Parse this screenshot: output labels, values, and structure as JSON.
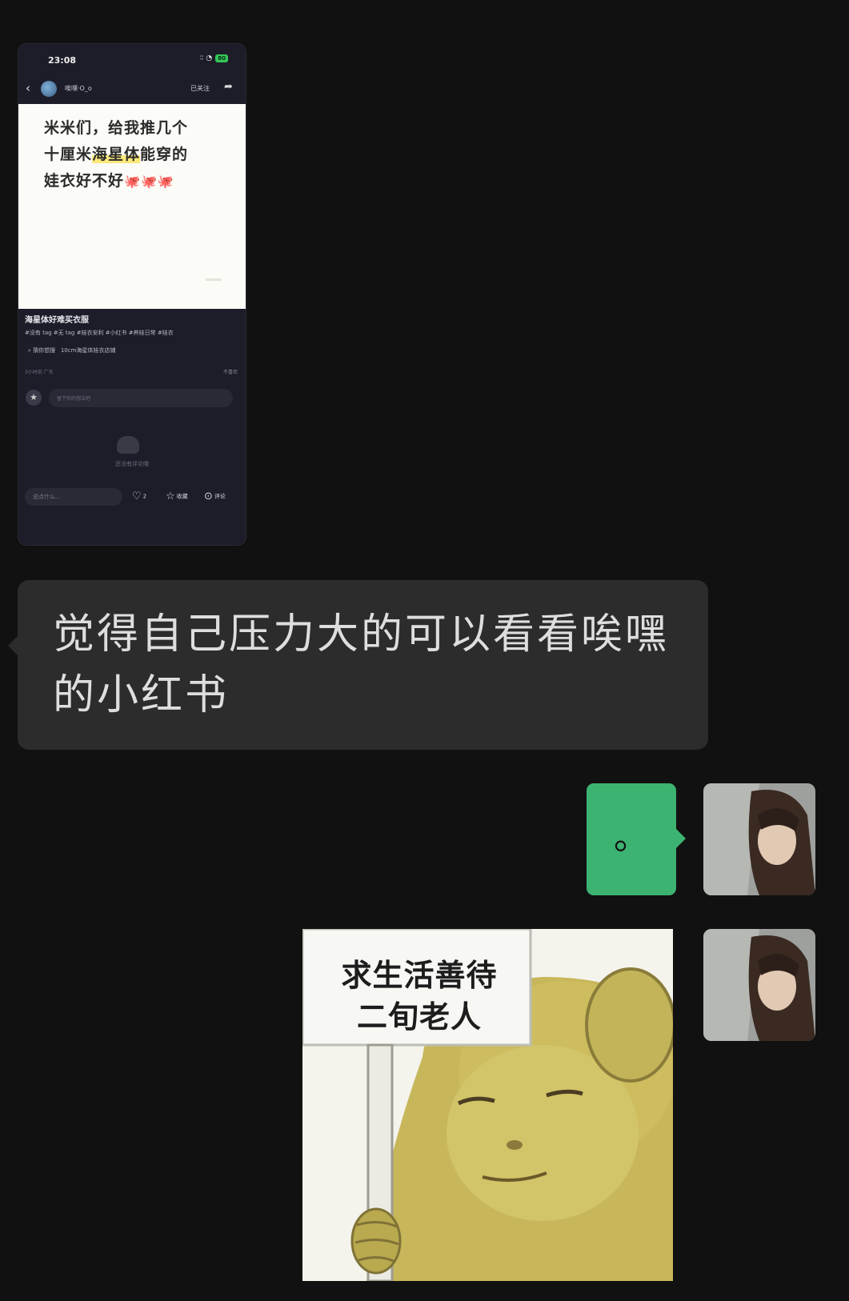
{
  "shared_screenshot": {
    "status_time": "23:08",
    "status_signal": "∶∶ ◔",
    "battery": "80",
    "author_name": "唉嘿·O_o",
    "follow_label": "已关注",
    "note_line1": "米米们，给我推几个",
    "note_line2_pre": "十厘米",
    "note_line2_hl": "海星体",
    "note_line2_post": "能穿的",
    "note_line3": "娃衣好不好",
    "note_emoji": "🐙🐙🐙",
    "post_title": "海星体好难买衣服",
    "tags": "#没有 tag #无 tag #娃衣安利 #小红书 #养娃日常 #娃衣",
    "search_prefix": "猜你想搜",
    "search_query": "10cm海星体娃衣店铺",
    "meta_left": "3小时前 广东",
    "meta_right": "不喜欢",
    "comment_placeholder": "留下你的想法吧",
    "no_comments": "还没有评论哦",
    "say_placeholder": "说点什么...",
    "like_count": "2",
    "collect_label": "收藏",
    "comment_label": "评论"
  },
  "messages": {
    "left_text": "觉得自己压力大的可以看看唉嘿的小红书",
    "right_text": "。",
    "sticker_text_line1": "求生活善待",
    "sticker_text_line2": "二旬老人"
  },
  "colors": {
    "background": "#111111",
    "left_bubble": "#2c2c2c",
    "right_bubble": "#3cb371"
  },
  "icons": [
    "back-icon",
    "share-icon",
    "search-icon",
    "heart-icon",
    "star-icon",
    "comment-icon",
    "mic-icon",
    "image-icon"
  ]
}
